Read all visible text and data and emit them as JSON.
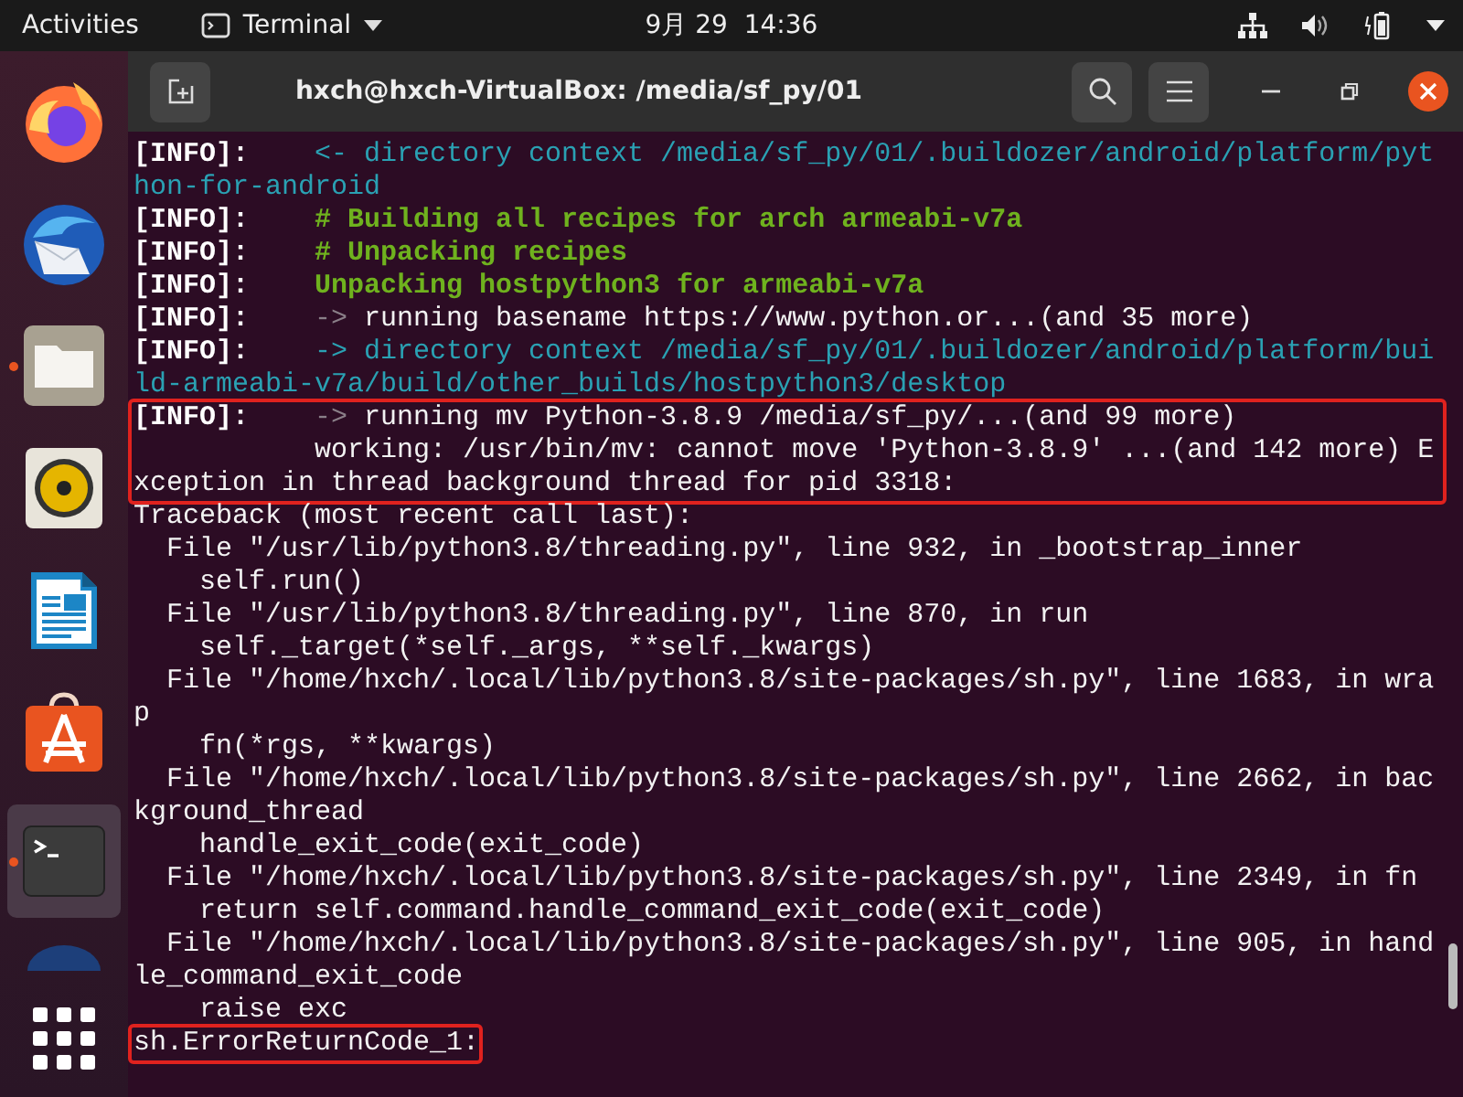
{
  "top_bar": {
    "activities": "Activities",
    "app_menu": "Terminal",
    "clock": "9月 29  14:36"
  },
  "dock": {
    "items": [
      {
        "kind": "firefox",
        "running": false,
        "selected": false
      },
      {
        "kind": "mail",
        "running": false,
        "selected": false
      },
      {
        "kind": "files",
        "running": true,
        "selected": false
      },
      {
        "kind": "music",
        "running": false,
        "selected": false
      },
      {
        "kind": "writer",
        "running": false,
        "selected": false
      },
      {
        "kind": "store",
        "running": false,
        "selected": false
      },
      {
        "kind": "terminal",
        "running": true,
        "selected": true
      },
      {
        "kind": "disc",
        "running": false,
        "selected": false
      }
    ]
  },
  "window": {
    "title": "hxch@hxch-VirtualBox: /media/sf_py/01"
  },
  "terminal": {
    "blocks": [
      {
        "boxed": false,
        "lines": [
          [
            {
              "kind": "tag",
              "text": "[INFO]:"
            },
            {
              "kind": "dir",
              "text": "    <- directory context /media/sf_py/01/.buildozer/android/platform/python-for-android"
            }
          ],
          [
            {
              "kind": "tag",
              "text": "[INFO]:"
            },
            {
              "kind": "green",
              "text": "    # Building all recipes for arch armeabi-v7a"
            }
          ],
          [
            {
              "kind": "tag",
              "text": "[INFO]:"
            },
            {
              "kind": "green",
              "text": "    # Unpacking recipes"
            }
          ],
          [
            {
              "kind": "tag",
              "text": "[INFO]:"
            },
            {
              "kind": "green",
              "text": "    Unpacking hostpython3 for armeabi-v7a"
            }
          ],
          [
            {
              "kind": "tag",
              "text": "[INFO]:"
            },
            {
              "kind": "arrow",
              "text": "    ->"
            },
            {
              "kind": "plain",
              "text": " running basename https://www.python.or...(and 35 more)"
            }
          ],
          [
            {
              "kind": "tag",
              "text": "[INFO]:"
            },
            {
              "kind": "dir",
              "text": "    -> directory context /media/sf_py/01/.buildozer/android/platform/build-armeabi-v7a/build/other_builds/hostpython3/desktop"
            }
          ]
        ]
      },
      {
        "boxed": true,
        "lines": [
          [
            {
              "kind": "tag",
              "text": "[INFO]:"
            },
            {
              "kind": "arrow",
              "text": "    ->"
            },
            {
              "kind": "plain",
              "text": " running mv Python-3.8.9 /media/sf_py/...(and 99 more)"
            }
          ],
          [
            {
              "kind": "plain",
              "text": "           working: /usr/bin/mv: cannot move 'Python-3.8.9' ...(and 142 more) Exception in thread background thread for pid 3318:"
            }
          ]
        ]
      },
      {
        "boxed": false,
        "lines": [
          [
            {
              "kind": "plain",
              "text": "Traceback (most recent call last):"
            }
          ],
          [
            {
              "kind": "plain",
              "text": "  File \"/usr/lib/python3.8/threading.py\", line 932, in _bootstrap_inner"
            }
          ],
          [
            {
              "kind": "plain",
              "text": "    self.run()"
            }
          ],
          [
            {
              "kind": "plain",
              "text": "  File \"/usr/lib/python3.8/threading.py\", line 870, in run"
            }
          ],
          [
            {
              "kind": "plain",
              "text": "    self._target(*self._args, **self._kwargs)"
            }
          ],
          [
            {
              "kind": "plain",
              "text": "  File \"/home/hxch/.local/lib/python3.8/site-packages/sh.py\", line 1683, in wrap"
            }
          ],
          [
            {
              "kind": "plain",
              "text": "    fn(*rgs, **kwargs)"
            }
          ],
          [
            {
              "kind": "plain",
              "text": "  File \"/home/hxch/.local/lib/python3.8/site-packages/sh.py\", line 2662, in background_thread"
            }
          ],
          [
            {
              "kind": "plain",
              "text": "    handle_exit_code(exit_code)"
            }
          ],
          [
            {
              "kind": "plain",
              "text": "  File \"/home/hxch/.local/lib/python3.8/site-packages/sh.py\", line 2349, in fn"
            }
          ],
          [
            {
              "kind": "plain",
              "text": "    return self.command.handle_command_exit_code(exit_code)"
            }
          ],
          [
            {
              "kind": "plain",
              "text": "  File \"/home/hxch/.local/lib/python3.8/site-packages/sh.py\", line 905, in handle_command_exit_code"
            }
          ],
          [
            {
              "kind": "plain",
              "text": "    raise exc"
            }
          ]
        ]
      },
      {
        "boxed": true,
        "lines": [
          [
            {
              "kind": "plain",
              "text": "sh.ErrorReturnCode_1:"
            }
          ]
        ]
      }
    ]
  }
}
